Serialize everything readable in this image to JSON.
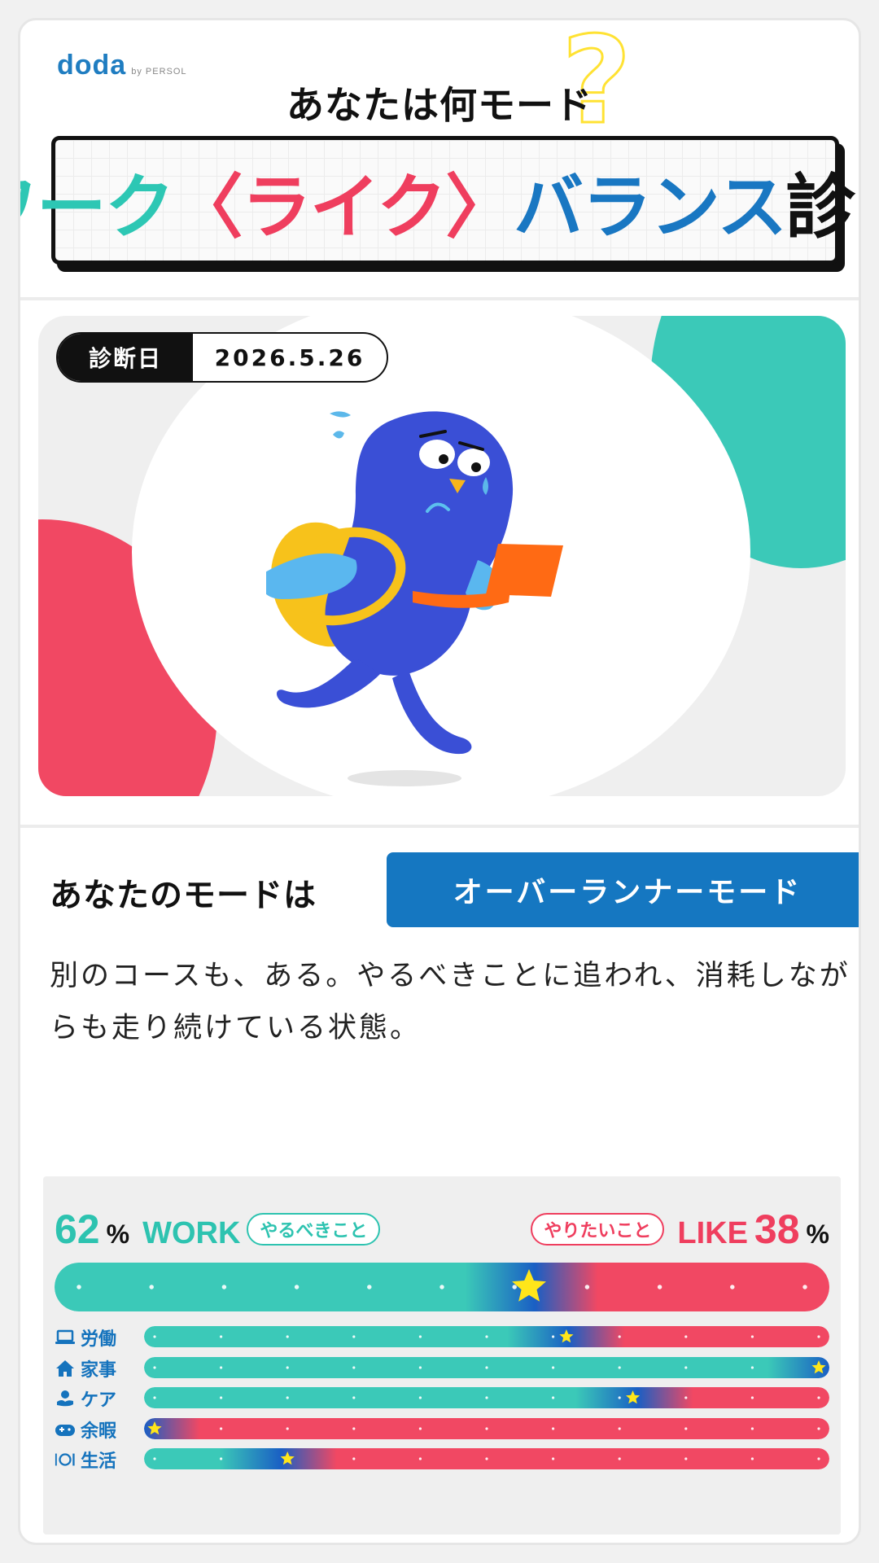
{
  "header": {
    "logo_text": "doda",
    "logo_sub": "by PERSOL",
    "question_mark": "?",
    "subtitle": "あなたは何モード",
    "title_parts": {
      "work": "ワーク",
      "like": "〈ライク〉",
      "balance": "バランス",
      "diagnosis": "診断"
    }
  },
  "hero": {
    "date_label": "診断日",
    "date_value": "2026.5.26"
  },
  "result": {
    "mode_prefix": "あなたのモードは",
    "mode_name": "オーバーランナーモード",
    "description": "別のコースも、ある。やるべきことに追われ、消耗しながらも走り続けている状態。"
  },
  "balance": {
    "work_percent": "62",
    "like_percent": "38",
    "percent_sign": "%",
    "work_label": "WORK",
    "like_label": "LIKE",
    "work_tag": "やるべきこと",
    "like_tag": "やりたいこと",
    "main_value": 0.62,
    "categories": [
      {
        "label": "労働",
        "icon": "laptop-icon",
        "value": 0.62
      },
      {
        "label": "家事",
        "icon": "house-icon",
        "value": 1.0
      },
      {
        "label": "ケア",
        "icon": "care-icon",
        "value": 0.72
      },
      {
        "label": "余暇",
        "icon": "gamepad-icon",
        "value": 0.0
      },
      {
        "label": "生活",
        "icon": "dining-icon",
        "value": 0.2
      }
    ]
  },
  "colors": {
    "work": "#3bc9b8",
    "like": "#f14863",
    "blend": "#1a5fc4",
    "star": "#ffe61a",
    "mode_badge": "#1577c1",
    "label_blue": "#1573bd"
  }
}
